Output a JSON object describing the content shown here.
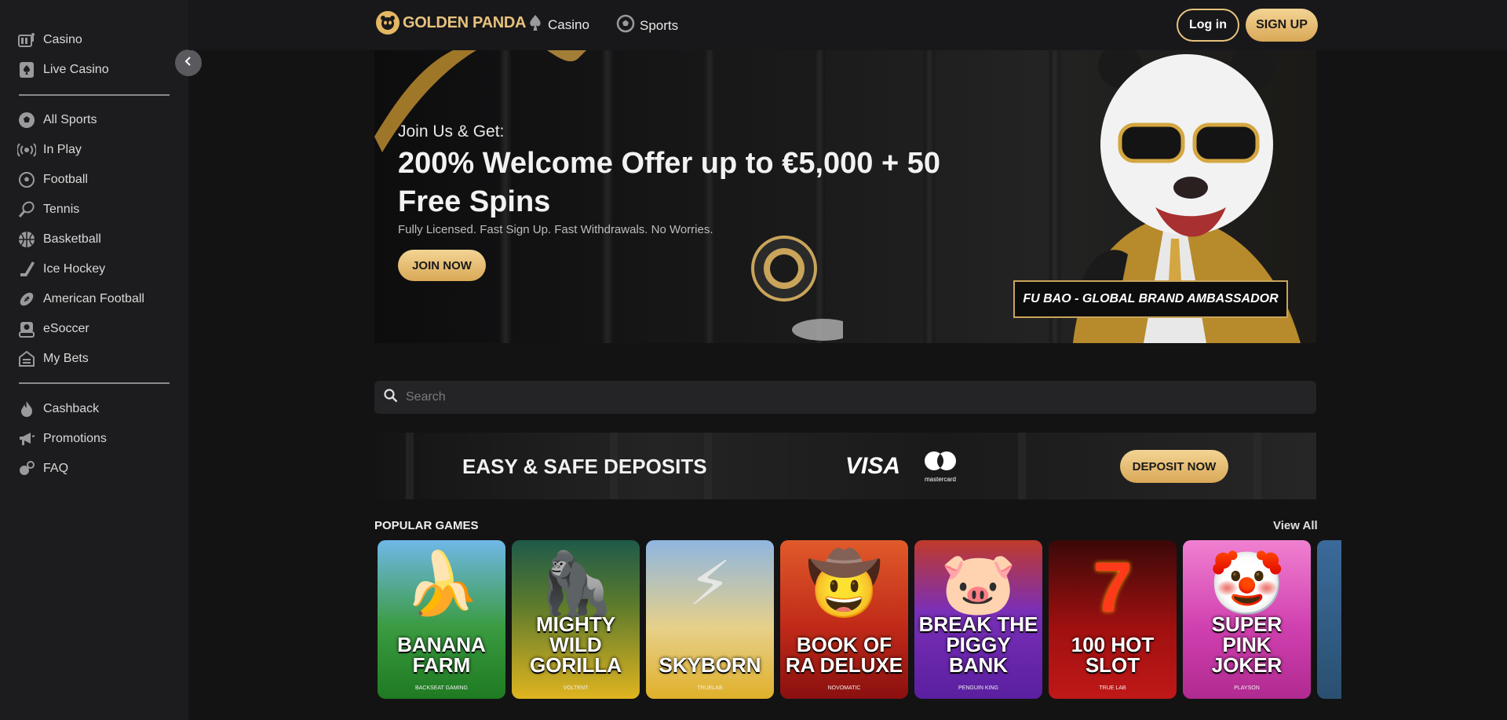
{
  "sidebar": {
    "top_items": [
      {
        "label": "Casino",
        "icon": "slot-machine-icon"
      },
      {
        "label": "Live Casino",
        "icon": "spade-card-icon"
      }
    ],
    "sport_items": [
      {
        "label": "All Sports",
        "icon": "soccer-ball-icon"
      },
      {
        "label": "In Play",
        "icon": "broadcast-icon"
      },
      {
        "label": "Football",
        "icon": "football-icon"
      },
      {
        "label": "Tennis",
        "icon": "tennis-racket-icon"
      },
      {
        "label": "Basketball",
        "icon": "basketball-icon"
      },
      {
        "label": "Ice Hockey",
        "icon": "hockey-stick-icon"
      },
      {
        "label": "American Football",
        "icon": "american-football-icon"
      },
      {
        "label": "eSoccer",
        "icon": "esoccer-icon"
      },
      {
        "label": "My Bets",
        "icon": "betslip-icon"
      }
    ],
    "bottom_items": [
      {
        "label": "Cashback",
        "icon": "flame-icon"
      },
      {
        "label": "Promotions",
        "icon": "megaphone-icon"
      },
      {
        "label": "FAQ",
        "icon": "faq-icon"
      }
    ]
  },
  "header": {
    "logo_text": "GOLDEN PANDA",
    "nav": [
      {
        "label": "Casino",
        "icon": "spade-icon"
      },
      {
        "label": "Sports",
        "icon": "soccer-ball-icon"
      }
    ],
    "login_label": "Log in",
    "signup_label": "SIGN UP"
  },
  "hero": {
    "subtitle": "Join Us & Get:",
    "title": "200% Welcome Offer up to €5,000 + 50 Free Spins",
    "description": "Fully Licensed. Fast Sign Up. Fast Withdrawals. No Worries.",
    "cta_label": "JOIN NOW",
    "ambassador_label": "FU BAO - GLOBAL BRAND AMBASSADOR"
  },
  "search": {
    "placeholder": "Search",
    "value": ""
  },
  "deposit_banner": {
    "title": "EASY & SAFE DEPOSITS",
    "visa_label": "VISA",
    "mastercard_label": "mastercard",
    "cta_label": "DEPOSIT NOW"
  },
  "popular_games": {
    "title": "POPULAR GAMES",
    "view_all_label": "View All",
    "games": [
      {
        "title": "BANANA FARM",
        "provider": "BACKSEAT GAMING",
        "bg": "#2f9a3a"
      },
      {
        "title": "MIGHTY WILD GORILLA",
        "provider": "VOLTENT",
        "bg": "#b68a1a"
      },
      {
        "title": "SKYBORN",
        "provider": "TRUELAB",
        "bg": "#d8b84a"
      },
      {
        "title": "BOOK OF RA DELUXE",
        "provider": "NOVOMATIC",
        "bg": "#b3261b"
      },
      {
        "title": "BREAK THE PIGGY BANK",
        "provider": "PENGUIN KING",
        "bg": "#6b2fb8"
      },
      {
        "title": "100 HOT SLOT",
        "provider": "TRUE LAB",
        "bg": "#b0100f"
      },
      {
        "title": "SUPER PINK JOKER",
        "provider": "PLAYSON",
        "bg": "#d43fb0"
      }
    ]
  },
  "colors": {
    "accent_gold": "#e7c27d",
    "background": "#131314",
    "sidebar": "#1c1c1e"
  }
}
